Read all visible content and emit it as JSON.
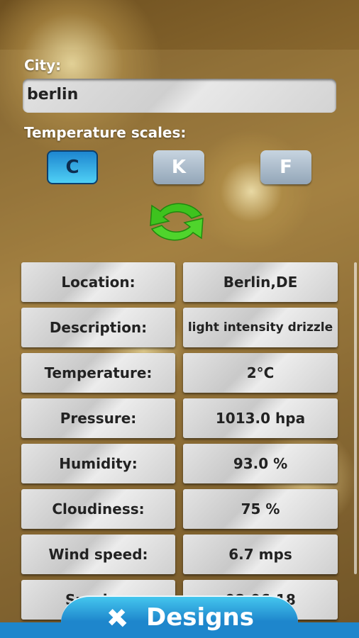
{
  "city": {
    "label": "City:",
    "value": "berlin"
  },
  "scales": {
    "label": "Temperature scales:",
    "options": [
      "C",
      "K",
      "F"
    ],
    "selected": "C"
  },
  "rows": [
    {
      "label": "Location:",
      "value": "Berlin,DE"
    },
    {
      "label": "Description:",
      "value": "light intensity drizzle"
    },
    {
      "label": "Temperature:",
      "value": "2°C"
    },
    {
      "label": "Pressure:",
      "value": "1013.0 hpa"
    },
    {
      "label": "Humidity:",
      "value": "93.0 %"
    },
    {
      "label": "Cloudiness:",
      "value": "75 %"
    },
    {
      "label": "Wind speed:",
      "value": "6.7 mps"
    },
    {
      "label": "Sunrise:",
      "value": "08:06:18"
    }
  ],
  "footer": {
    "label": "Designs",
    "icon": "pencil-ruler-icon"
  },
  "colors": {
    "accent": "#1e86cc",
    "selected": "#3bb8ea"
  }
}
